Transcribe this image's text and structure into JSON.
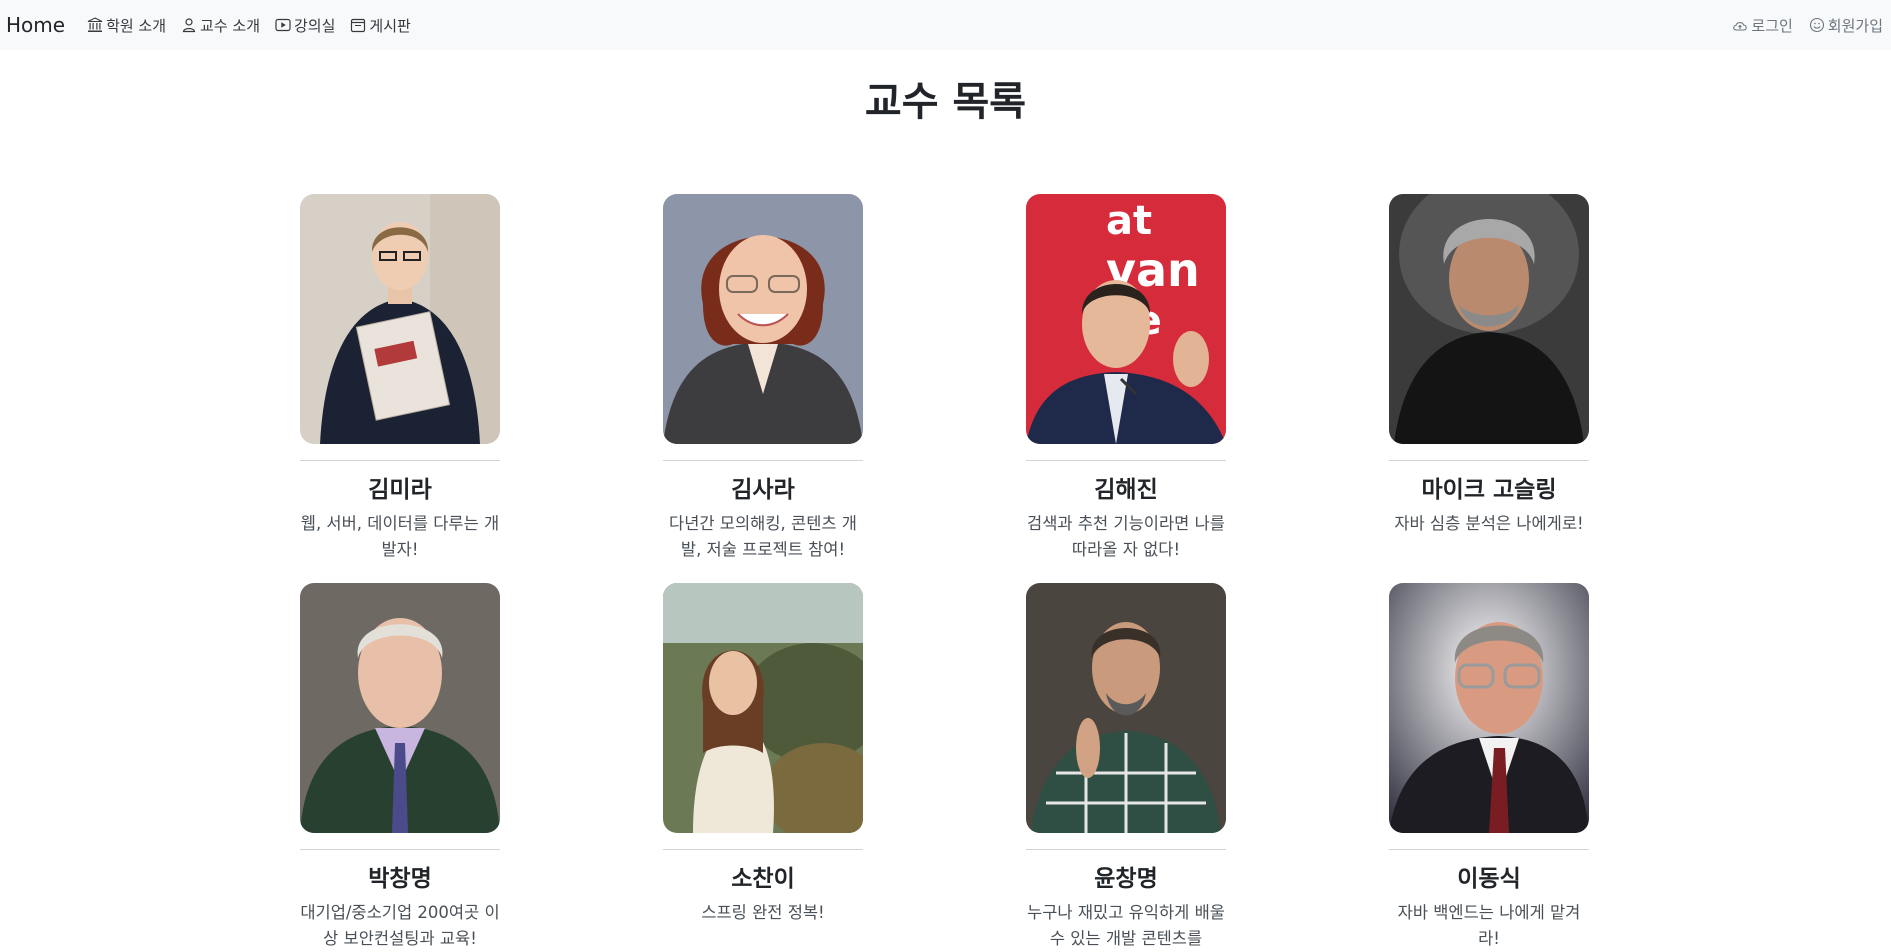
{
  "nav": {
    "brand": "Home",
    "links": [
      {
        "label": "학원 소개",
        "icon": "bank-icon"
      },
      {
        "label": "교수 소개",
        "icon": "person-icon"
      },
      {
        "label": "강의실",
        "icon": "play-icon"
      },
      {
        "label": "게시판",
        "icon": "calendar-icon"
      }
    ],
    "right": [
      {
        "label": "로그인",
        "icon": "cloud-upload-icon"
      },
      {
        "label": "회원가입",
        "icon": "smile-icon"
      }
    ]
  },
  "page": {
    "title": "교수 목록"
  },
  "professors": [
    {
      "name": "김미라",
      "desc": "웹, 서버, 데이터를 다루는 개발자!",
      "photo": "woman-with-book-portrait"
    },
    {
      "name": "김사라",
      "desc": "다년간 모의해킹, 콘텐츠 개발, 저술 프로젝트 참여!",
      "photo": "red-haired-woman-portrait"
    },
    {
      "name": "김해진",
      "desc": "검색과 추천 기능이라면 나를 따라올 자 없다!",
      "photo": "speaker-red-background-portrait"
    },
    {
      "name": "마이크 고슬링",
      "desc": "자바 심층 분석은 나에게로!",
      "photo": "grey-haired-man-portrait"
    },
    {
      "name": "박창명",
      "desc": "대기업/중소기업 200여곳 이상 보안컨설팅과 교육!",
      "photo": "elderly-man-tie-portrait"
    },
    {
      "name": "소찬이",
      "desc": "스프링 완전 정복!",
      "photo": "woman-forest-portrait"
    },
    {
      "name": "윤창명",
      "desc": "누구나 재밌고 유익하게 배울 수 있는 개발 콘텐츠를",
      "photo": "man-plaid-shirt-portrait"
    },
    {
      "name": "이동식",
      "desc": "자바 백엔드는 나에게 맡겨라!",
      "photo": "man-glasses-suit-portrait"
    }
  ]
}
